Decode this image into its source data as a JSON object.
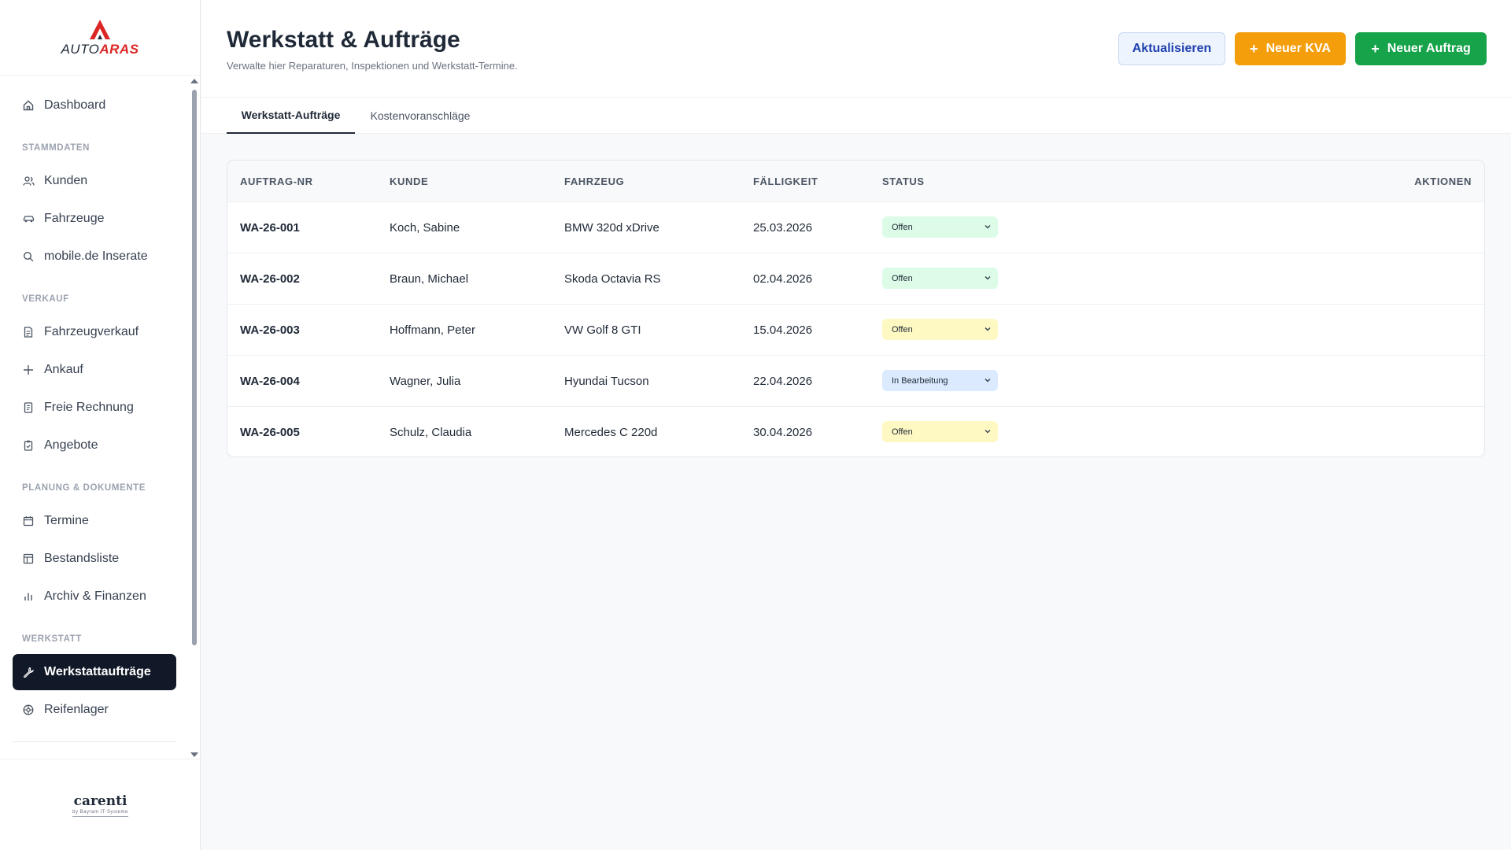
{
  "app": {
    "logo_part1": "AUTO",
    "logo_part2": "ARAS",
    "footer_brand": "carenti",
    "footer_sub": "by Bayram IT-Systeme"
  },
  "sidebar": {
    "items": [
      {
        "label": "Dashboard",
        "icon": "home-icon"
      },
      {
        "section": "STAMMDATEN"
      },
      {
        "label": "Kunden",
        "icon": "users-icon"
      },
      {
        "label": "Fahrzeuge",
        "icon": "car-icon"
      },
      {
        "label": "mobile.de Inserate",
        "icon": "search-icon"
      },
      {
        "section": "VERKAUF"
      },
      {
        "label": "Fahrzeugverkauf",
        "icon": "file-icon"
      },
      {
        "label": "Ankauf",
        "icon": "plus-icon"
      },
      {
        "label": "Freie Rechnung",
        "icon": "receipt-icon"
      },
      {
        "label": "Angebote",
        "icon": "clipboard-icon"
      },
      {
        "section": "PLANUNG & DOKUMENTE"
      },
      {
        "label": "Termine",
        "icon": "calendar-icon"
      },
      {
        "label": "Bestandsliste",
        "icon": "table-icon"
      },
      {
        "label": "Archiv & Finanzen",
        "icon": "bar-chart-icon"
      },
      {
        "section": "WERKSTATT"
      },
      {
        "label": "Werkstattaufträge",
        "icon": "wrench-icon",
        "active": true
      },
      {
        "label": "Reifenlager",
        "icon": "tire-icon"
      }
    ]
  },
  "header": {
    "title": "Werkstatt & Aufträge",
    "subtitle": "Verwalte hier Reparaturen, Inspektionen und Werkstatt-Termine.",
    "refresh_label": "Aktualisieren",
    "new_kva_label": "Neuer KVA",
    "new_order_label": "Neuer Auftrag"
  },
  "tabs": [
    {
      "label": "Werkstatt-Aufträge",
      "active": true
    },
    {
      "label": "Kostenvoranschläge",
      "active": false
    }
  ],
  "table": {
    "columns": [
      "AUFTRAG-NR",
      "KUNDE",
      "FAHRZEUG",
      "FÄLLIGKEIT",
      "STATUS",
      "AKTIONEN"
    ],
    "rows": [
      {
        "nr": "WA-26-001",
        "kunde": "Koch, Sabine",
        "fahrzeug": "BMW 320d xDrive",
        "faellig": "25.03.2026",
        "status": "Offen",
        "status_color": "#dcfce7"
      },
      {
        "nr": "WA-26-002",
        "kunde": "Braun, Michael",
        "fahrzeug": "Skoda Octavia RS",
        "faellig": "02.04.2026",
        "status": "Offen",
        "status_color": "#dcfce7"
      },
      {
        "nr": "WA-26-003",
        "kunde": "Hoffmann, Peter",
        "fahrzeug": "VW Golf 8 GTI",
        "faellig": "15.04.2026",
        "status": "Offen",
        "status_color": "#fef9c3"
      },
      {
        "nr": "WA-26-004",
        "kunde": "Wagner, Julia",
        "fahrzeug": "Hyundai Tucson",
        "faellig": "22.04.2026",
        "status": "In Bearbeitung",
        "status_color": "#dbeafe"
      },
      {
        "nr": "WA-26-005",
        "kunde": "Schulz, Claudia",
        "fahrzeug": "Mercedes C 220d",
        "faellig": "30.04.2026",
        "status": "Offen",
        "status_color": "#fef9c3"
      }
    ]
  },
  "colors": {
    "accent_dark": "#111827",
    "brand_red": "#dc2626",
    "kva_orange": "#f59e0b",
    "order_green": "#16a34a"
  }
}
